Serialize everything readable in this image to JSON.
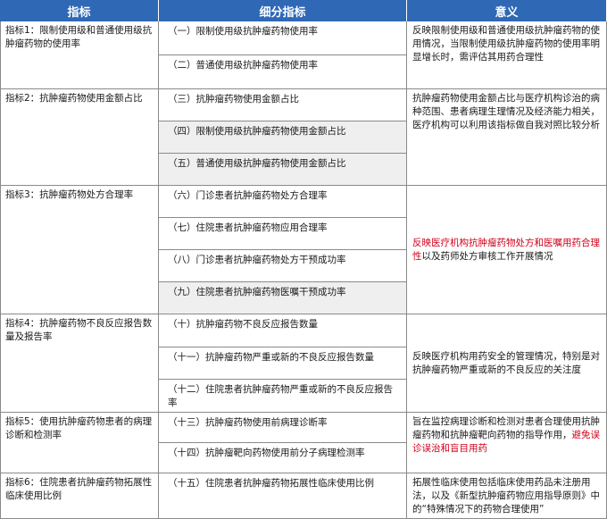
{
  "header": {
    "col1": "指标",
    "col2": "细分指标",
    "col3": "意义"
  },
  "rows": [
    {
      "indicator": "指标1：限制使用级和普通使用级抗肿瘤药物的使用率",
      "subs": [
        "（一）限制使用级抗肿瘤药物使用率",
        "（二）普通使用级抗肿瘤药物使用率"
      ],
      "meaning": "反映限制使用级和普通使用级抗肿瘤药物的使用情况，当限制使用级抗肿瘤药物的使用率明显增长时，需评估其用药合理性"
    },
    {
      "indicator": "指标2：抗肿瘤药物使用金额占比",
      "subs": [
        "（三）抗肿瘤药物使用金额占比",
        "（四）限制使用级抗肿瘤药物使用金额占比",
        "（五）普通使用级抗肿瘤药物使用金额占比"
      ],
      "meaning": "抗肿瘤药物使用金额占比与医疗机构诊治的病种范围、患者病理生理情况及经济能力相关，医疗机构可以利用该指标做自我对照比较分析"
    },
    {
      "indicator": "指标3：抗肿瘤药物处方合理率",
      "subs": [
        "（六）门诊患者抗肿瘤药物处方合理率",
        "（七）住院患者抗肿瘤药物应用合理率",
        "（八）门诊患者抗肿瘤药物处方干预成功率",
        "（九）住院患者抗肿瘤药物医嘱干预成功率"
      ],
      "meaning_red": "反映医疗机构抗肿瘤药物处方和医嘱用药合理性",
      "meaning_rest": "以及药师处方审核工作开展情况"
    },
    {
      "indicator": "指标4：抗肿瘤药物不良反应报告数量及报告率",
      "subs": [
        "（十）抗肿瘤药物不良反应报告数量",
        "（十一）抗肿瘤药物严重或新的不良反应报告数量",
        "（十二）住院患者抗肿瘤药物严重或新的不良反应报告率"
      ],
      "meaning": "反映医疗机构用药安全的管理情况，特别是对抗肿瘤药物严重或新的不良反应的关注度"
    },
    {
      "indicator": "指标5：使用抗肿瘤药物患者的病理诊断和检测率",
      "subs": [
        "（十三）抗肿瘤药物使用前病理诊断率",
        "（十四）抗肿瘤靶向药物使用前分子病理检测率"
      ],
      "meaning": "旨在监控病理诊断和检测对患者合理使用抗肿瘤药物和抗肿瘤靶向药物的指导作用，",
      "meaning_red": "避免误诊误治和盲目用药"
    },
    {
      "indicator": "指标6：住院患者抗肿瘤药物拓展性临床使用比例",
      "subs": [
        "（十五）住院患者抗肿瘤药物拓展性临床使用比例"
      ],
      "meaning": "拓展性临床使用包括临床使用药品未注册用法，以及《新型抗肿瘤药物应用指导原则》中的“特殊情况下的药物合理使用”"
    }
  ]
}
